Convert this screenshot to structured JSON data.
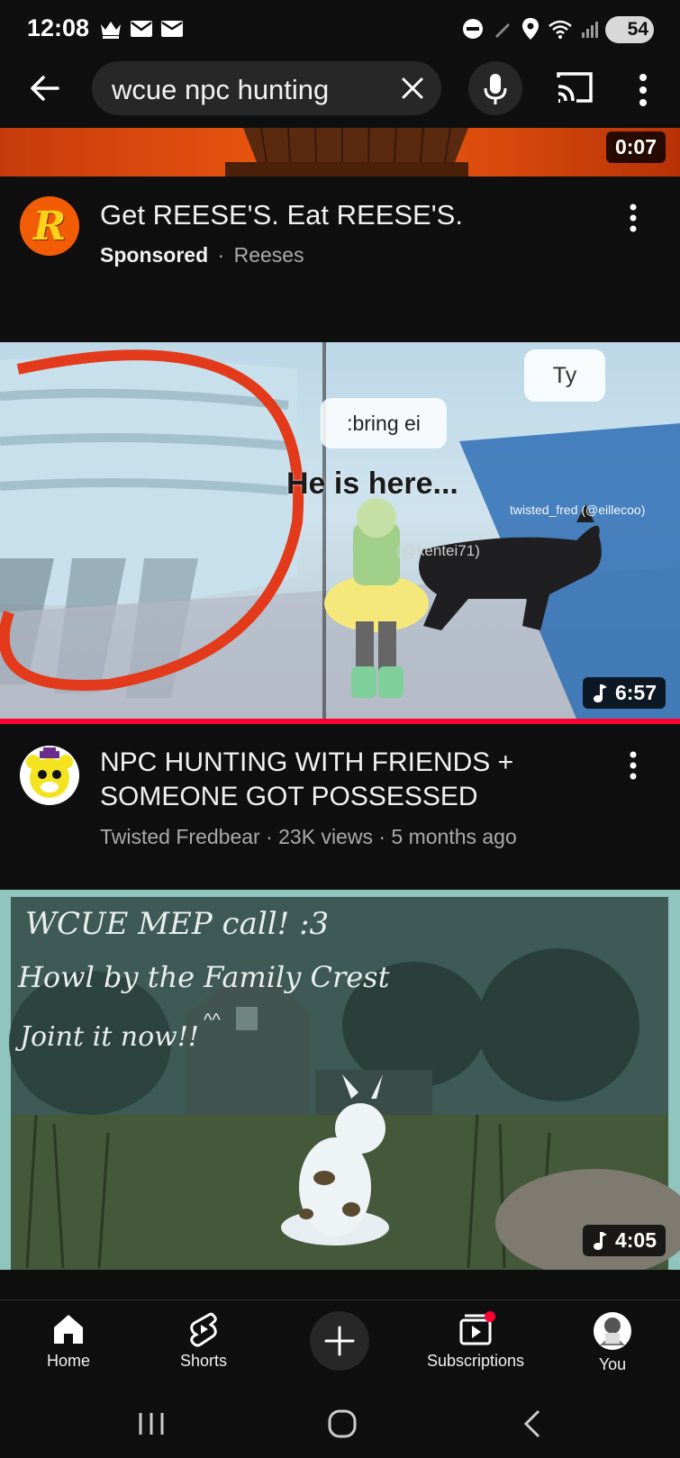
{
  "status_bar": {
    "time": "12:08",
    "battery": "54"
  },
  "top_bar": {
    "search_query": "wcue npc hunting"
  },
  "ad": {
    "duration": "0:07",
    "avatar_letter": "R",
    "title": "Get REESE'S. Eat REESE'S.",
    "sponsored_label": "Sponsored",
    "separator": "·",
    "advertiser": "Reeses"
  },
  "video1": {
    "duration": "6:57",
    "bubble_1": ":bring ei",
    "bubble_2": "Ty",
    "overlay_text": "He is here...",
    "username_tag_1": "twisted_fred (@eillecoo)",
    "username_tag_2": "(@kentei71)",
    "title": "NPC HUNTING WITH FRIENDS + SOMEONE GOT POSSESSED",
    "meta": "Twisted Fredbear · 23K views · 5 months ago"
  },
  "video2": {
    "duration": "4:05",
    "handwriting_1": "WCUE MEP call! :3",
    "handwriting_2": "Howl by the Family Crest",
    "handwriting_3": "Joint it now!!",
    "handwriting_4": "^^"
  },
  "bottom_nav": {
    "home": "Home",
    "shorts": "Shorts",
    "subscriptions": "Subscriptions",
    "you": "You"
  },
  "colors": {
    "background": "#0f0f0f",
    "progress_red": "#ff0033",
    "reeses_orange": "#f25c05"
  }
}
